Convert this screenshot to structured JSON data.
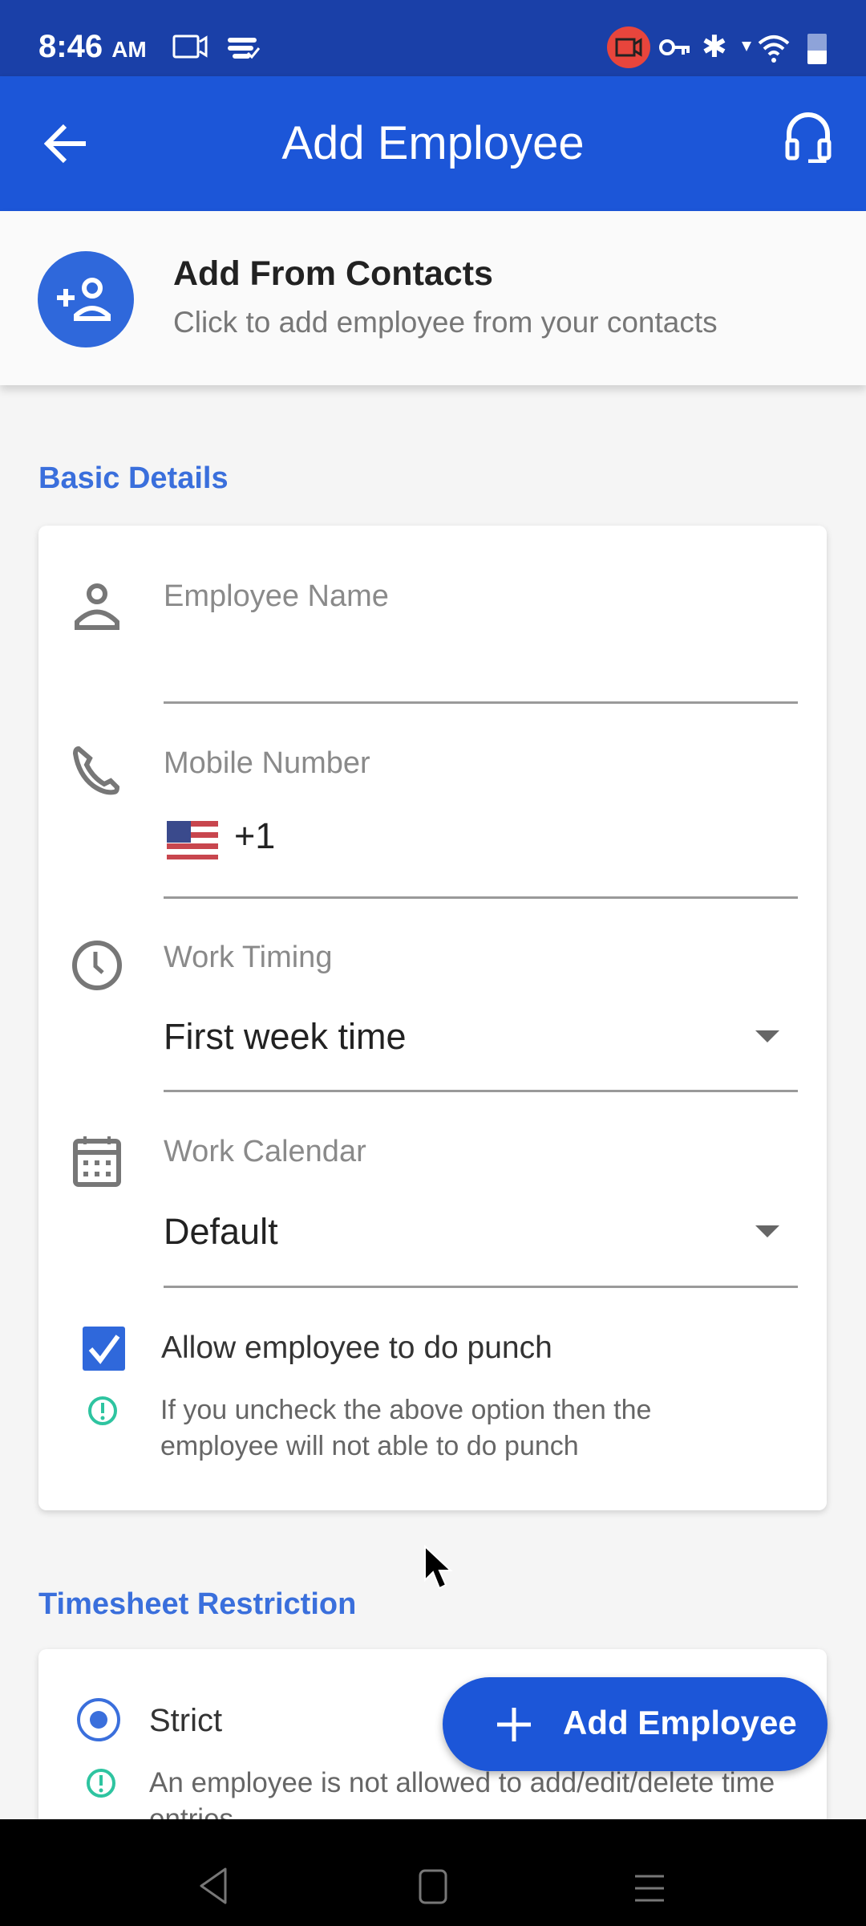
{
  "status_bar": {
    "time": "8:46",
    "ampm": "AM",
    "icons_left": [
      "screen-record-icon",
      "sync-check-icon"
    ],
    "icons_right": [
      "camera-recording-icon",
      "vpn-key-icon",
      "bluetooth-icon",
      "data-arrow-icon",
      "wifi-icon",
      "battery-icon"
    ],
    "recording_color": "#e8453c"
  },
  "app_bar": {
    "title": "Add Employee",
    "back_icon": "arrow-left-icon",
    "support_icon": "headset-icon",
    "color": "#1c56d8"
  },
  "contacts": {
    "title": "Add From Contacts",
    "subtitle": "Click to add employee from your contacts",
    "icon": "add-person-icon"
  },
  "basic_details": {
    "section_title": "Basic Details",
    "employee_name": {
      "label": "Employee Name",
      "value": ""
    },
    "mobile_number": {
      "label": "Mobile Number",
      "country_flag": "US",
      "country_code": "+1",
      "value": ""
    },
    "work_timing": {
      "label": "Work Timing",
      "value": "First week time"
    },
    "work_calendar": {
      "label": "Work Calendar",
      "value": "Default"
    },
    "allow_punch": {
      "label": "Allow employee to do punch",
      "checked": true
    },
    "punch_hint_line1": "If you uncheck the above option then the",
    "punch_hint_line2": "employee will not able to do punch"
  },
  "timesheet_restriction": {
    "section_title": "Timesheet Restriction",
    "option_strict": {
      "label": "Strict",
      "selected": true
    },
    "strict_hint_line1": "An employee is not allowed to add/edit/delete time",
    "strict_hint_line2": "entries"
  },
  "fab": {
    "label": "Add Employee",
    "icon": "plus-icon"
  },
  "colors": {
    "accent": "#2f68db",
    "info": "#2ec4a0",
    "section": "#3a6fdc"
  }
}
